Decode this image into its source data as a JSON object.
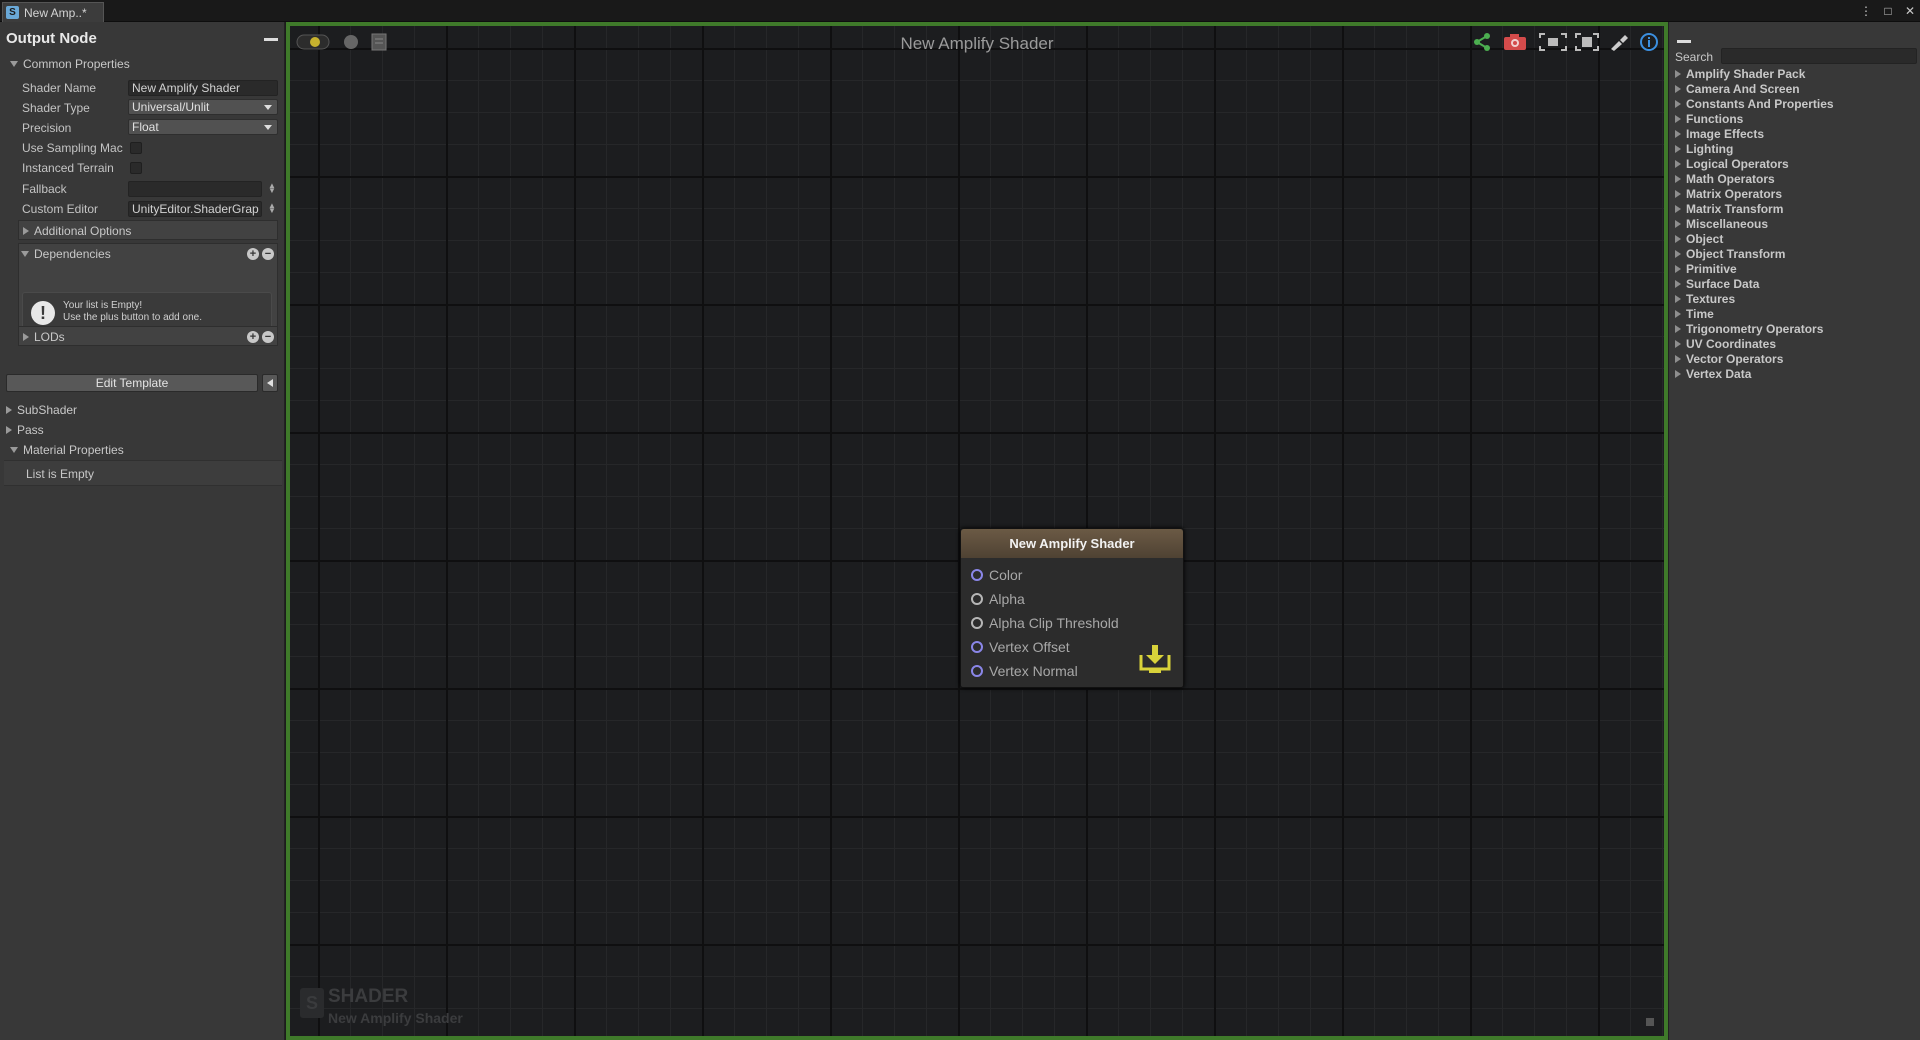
{
  "window": {
    "tab_label": "New Amp..*",
    "tab_icon_glyph": "S",
    "controls": [
      "⋮",
      "□",
      "✕"
    ]
  },
  "left_panel": {
    "title": "Output Node",
    "common_properties": {
      "header": "Common Properties",
      "shader_name_label": "Shader Name",
      "shader_name_value": "New Amplify Shader",
      "shader_type_label": "Shader Type",
      "shader_type_value": "Universal/Unlit",
      "precision_label": "Precision",
      "precision_value": "Float",
      "use_sampling_label": "Use Sampling Mac",
      "instanced_terrain_label": "Instanced Terrain",
      "fallback_label": "Fallback",
      "fallback_value": "",
      "custom_editor_label": "Custom Editor",
      "custom_editor_value": "UnityEditor.ShaderGrap",
      "additional_options": "Additional Options",
      "dependencies": "Dependencies",
      "empty_line1": "Your list is Empty!",
      "empty_line2": "Use the plus button to add one.",
      "lods": "LODs",
      "edit_template": "Edit Template"
    },
    "subshader": "SubShader",
    "pass": "Pass",
    "material_properties": "Material Properties",
    "material_list_empty": "List is Empty"
  },
  "canvas": {
    "title": "New Amplify Shader",
    "watermark_title": "SHADER",
    "watermark_subtitle": "New Amplify Shader",
    "toolbar_left_icons": [
      "live-mode-icon",
      "circle-icon",
      "clipboard-icon"
    ],
    "toolbar_right_icons": [
      "share-icon",
      "camera-icon",
      "focus-selection-icon",
      "fit-view-icon",
      "cleanup-icon",
      "info-icon"
    ]
  },
  "node": {
    "title": "New Amplify Shader",
    "ports": [
      {
        "label": "Color",
        "kind": "vector"
      },
      {
        "label": "Alpha",
        "kind": "float"
      },
      {
        "label": "Alpha Clip Threshold",
        "kind": "float"
      },
      {
        "label": "Vertex Offset",
        "kind": "vector"
      },
      {
        "label": "Vertex Normal",
        "kind": "vector"
      }
    ],
    "icon": "output-download-icon"
  },
  "right_panel": {
    "search_label": "Search",
    "search_value": "",
    "categories": [
      "Amplify Shader Pack",
      "Camera And Screen",
      "Constants And Properties",
      "Functions",
      "Image Effects",
      "Lighting",
      "Logical Operators",
      "Math Operators",
      "Matrix Operators",
      "Matrix Transform",
      "Miscellaneous",
      "Object",
      "Object Transform",
      "Primitive",
      "Surface Data",
      "Textures",
      "Time",
      "Trigonometry Operators",
      "UV Coordinates",
      "Vector Operators",
      "Vertex Data"
    ]
  },
  "colors": {
    "canvas_border": "#3f7a2a",
    "node_header": "#6b5a45",
    "vector_port": "#8a86e8",
    "accent_yellow": "#d8d23a",
    "info_blue": "#3b8fe0"
  }
}
